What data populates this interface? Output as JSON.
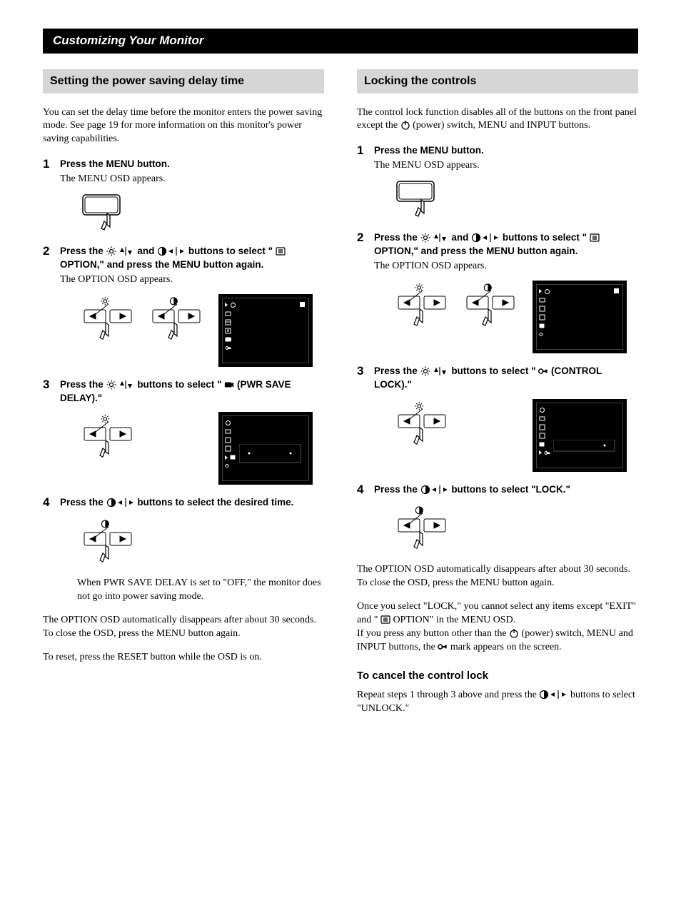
{
  "banner": "Customizing Your Monitor",
  "left": {
    "title": "Setting the power saving delay time",
    "intro": "You can set the delay time before the monitor enters the power saving mode. See page 19 for more information on this monitor's power saving capabilities.",
    "step1_title": "Press the MENU button.",
    "step1_body": "The MENU OSD appears.",
    "step2_pre": "Press the ",
    "step2_mid": " and ",
    "step2_post": " buttons to select \" ",
    "step2_end": " OPTION,\" and press the MENU button again.",
    "step2_body": "The OPTION OSD appears.",
    "step3_pre": "Press the ",
    "step3_mid": " buttons to select \" ",
    "step3_end": " (PWR SAVE DELAY).\"",
    "step4_pre": "Press the ",
    "step4_post": " buttons to select the desired time.",
    "note_delay": "When PWR SAVE DELAY is set to \"OFF,\" the monitor does not go into power saving mode.",
    "auto_close": "The OPTION OSD automatically disappears after about 30 seconds.",
    "close_instr": "To close the OSD, press the MENU button again.",
    "reset_instr": "To reset,  press the RESET button while the OSD is on."
  },
  "right": {
    "title": "Locking the controls",
    "intro_pre": "The control lock function disables all of the buttons on the front panel except the ",
    "intro_post": " (power) switch, MENU and INPUT buttons.",
    "step1_title": "Press the MENU button.",
    "step1_body": "The MENU OSD appears.",
    "step2_pre": "Press the ",
    "step2_mid": " and ",
    "step2_post": " buttons to select \" ",
    "step2_end": " OPTION,\" and press the MENU button again.",
    "step2_body": "The OPTION OSD appears.",
    "step3_pre": "Press the ",
    "step3_mid": " buttons to select \" ",
    "step3_end": " (CONTROL LOCK).\"",
    "step4_pre": "Press the ",
    "step4_post": " buttons to select \"LOCK.\"",
    "auto_close": "The OPTION OSD automatically disappears after about 30 seconds.",
    "close_instr": "To close the OSD, press the MENU button again.",
    "para2_1": "Once you select \"LOCK,\" you cannot select any items except \"EXIT\" and \" ",
    "para2_2": " OPTION\" in the MENU OSD.",
    "para2_3a": "If you press any button other than the ",
    "para2_3b": " (power) switch, MENU and INPUT buttons, the ",
    "para2_3c": " mark appears on the screen.",
    "cancel_head": "To cancel the control lock",
    "cancel_pre": "Repeat steps 1 through 3 above and press the ",
    "cancel_post": " buttons to select \"UNLOCK.\""
  }
}
